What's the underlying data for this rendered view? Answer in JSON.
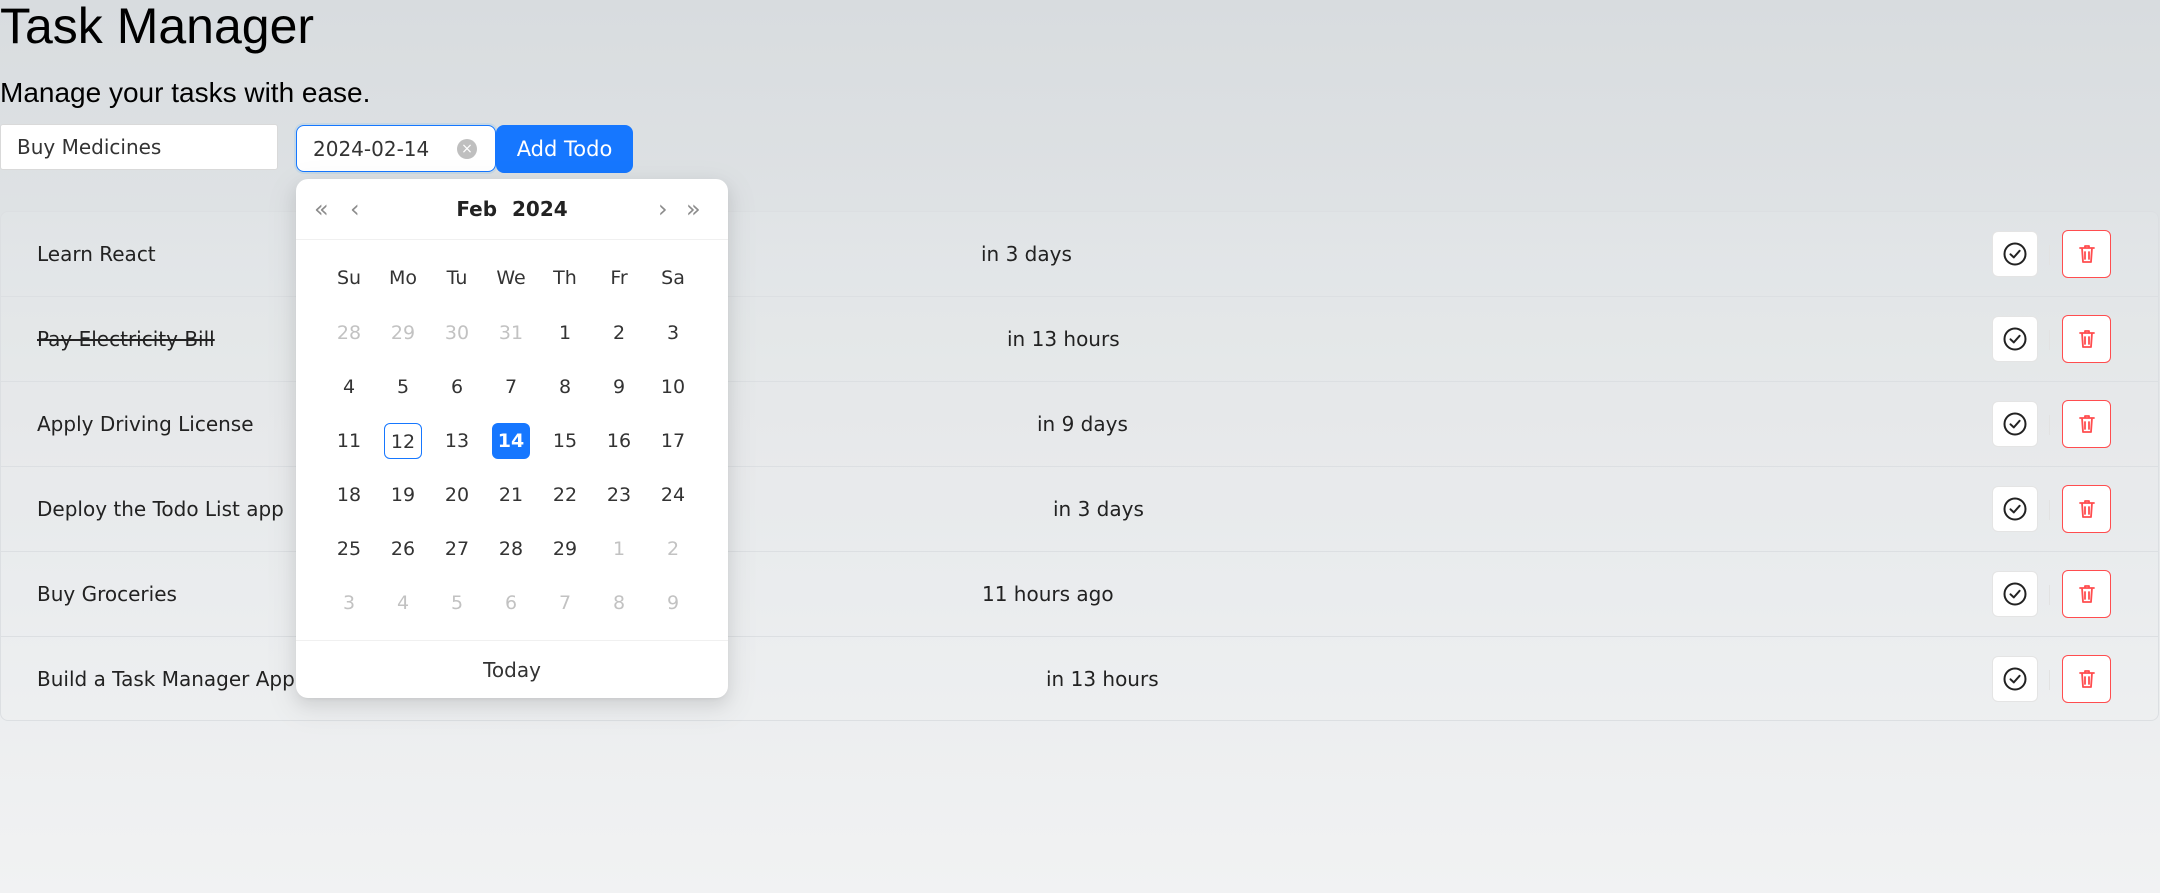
{
  "app": {
    "title": "Task Manager",
    "subtitle": "Manage your tasks with ease."
  },
  "form": {
    "task_value": "Buy Medicines",
    "date_value": "2024-02-14",
    "add_label": "Add Todo"
  },
  "todos": [
    {
      "title": "Learn React",
      "due": "in 3 days",
      "completed": false
    },
    {
      "title": "Pay Electricity Bill",
      "due": "in 13 hours",
      "completed": true
    },
    {
      "title": "Apply Driving License",
      "due": "in 9 days",
      "completed": false
    },
    {
      "title": "Deploy the Todo List app",
      "due": "in 3 days",
      "completed": false
    },
    {
      "title": "Buy Groceries",
      "due": "11 hours ago",
      "completed": false
    },
    {
      "title": "Build a Task Manager App",
      "due": "in 13 hours",
      "completed": false
    }
  ],
  "calendar": {
    "month": "Feb",
    "year": "2024",
    "weekdays": [
      "Su",
      "Mo",
      "Tu",
      "We",
      "Th",
      "Fr",
      "Sa"
    ],
    "weeks": [
      [
        "28",
        "29",
        "30",
        "31",
        "1",
        "2",
        "3"
      ],
      [
        "4",
        "5",
        "6",
        "7",
        "8",
        "9",
        "10"
      ],
      [
        "11",
        "12",
        "13",
        "14",
        "15",
        "16",
        "17"
      ],
      [
        "18",
        "19",
        "20",
        "21",
        "22",
        "23",
        "24"
      ],
      [
        "25",
        "26",
        "27",
        "28",
        "29",
        "1",
        "2"
      ],
      [
        "3",
        "4",
        "5",
        "6",
        "7",
        "8",
        "9"
      ]
    ],
    "today_label": "Today",
    "today_day": "12",
    "selected_day": "14",
    "nav": {
      "prev_year": "«",
      "prev_month": "‹",
      "next_month": "›",
      "next_year": "»"
    }
  },
  "icons": {
    "complete": "check-circle-icon",
    "delete": "trash-icon",
    "clear": "close-circle-icon"
  },
  "colors": {
    "primary": "#1677ff",
    "danger": "#ff4d4f",
    "muted_day": "#c2c2c2"
  }
}
